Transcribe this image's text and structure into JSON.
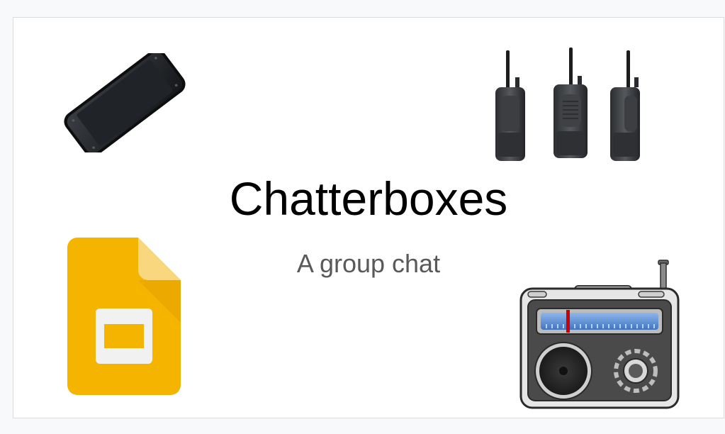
{
  "slide": {
    "title": "Chatterboxes",
    "subtitle": "A group chat"
  },
  "images": {
    "top_left": "smartphone-icon",
    "top_right": "walkie-talkie-icon",
    "bottom_left": "google-slides-icon",
    "bottom_right": "radio-icon"
  },
  "colors": {
    "slides_yellow": "#F4B400",
    "slides_fold": "#F9D77E",
    "radio_body": "#4a4a4a",
    "radio_dial": "#5b8fd6",
    "dial_needle": "#cc0000"
  }
}
